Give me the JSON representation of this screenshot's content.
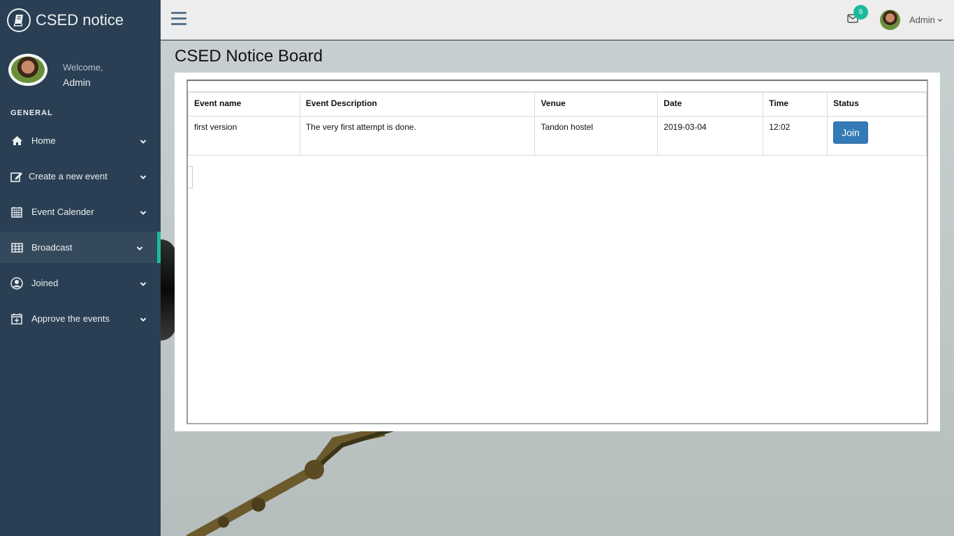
{
  "brand": {
    "title": "CSED notice"
  },
  "profile": {
    "welcome": "Welcome,",
    "name": "Admin"
  },
  "sidebar": {
    "section_title": "GENERAL",
    "items": [
      {
        "label": "Home",
        "icon": "home-icon"
      },
      {
        "label": "Create a new event",
        "icon": "edit-icon"
      },
      {
        "label": "Event Calender",
        "icon": "calendar-icon"
      },
      {
        "label": "Broadcast",
        "icon": "table-icon",
        "active": true
      },
      {
        "label": "Joined",
        "icon": "user-circle-icon"
      },
      {
        "label": "Approve the events",
        "icon": "calendar-plus-icon"
      }
    ]
  },
  "topbar": {
    "mail_count": "6",
    "user_name": "Admin"
  },
  "page": {
    "title": "CSED Notice Board"
  },
  "table": {
    "headers": [
      "Event name",
      "Event Description",
      "Venue",
      "Date",
      "Time",
      "Status"
    ],
    "rows": [
      {
        "event_name": "first version",
        "description": "The very first attempt is done.",
        "venue": "Tandon hostel",
        "date": "2019-03-04",
        "time": "12:02",
        "status_button": "Join"
      }
    ]
  },
  "colors": {
    "sidebar": "#2a3f54",
    "accent": "#1abb9c",
    "button": "#337ab7"
  }
}
